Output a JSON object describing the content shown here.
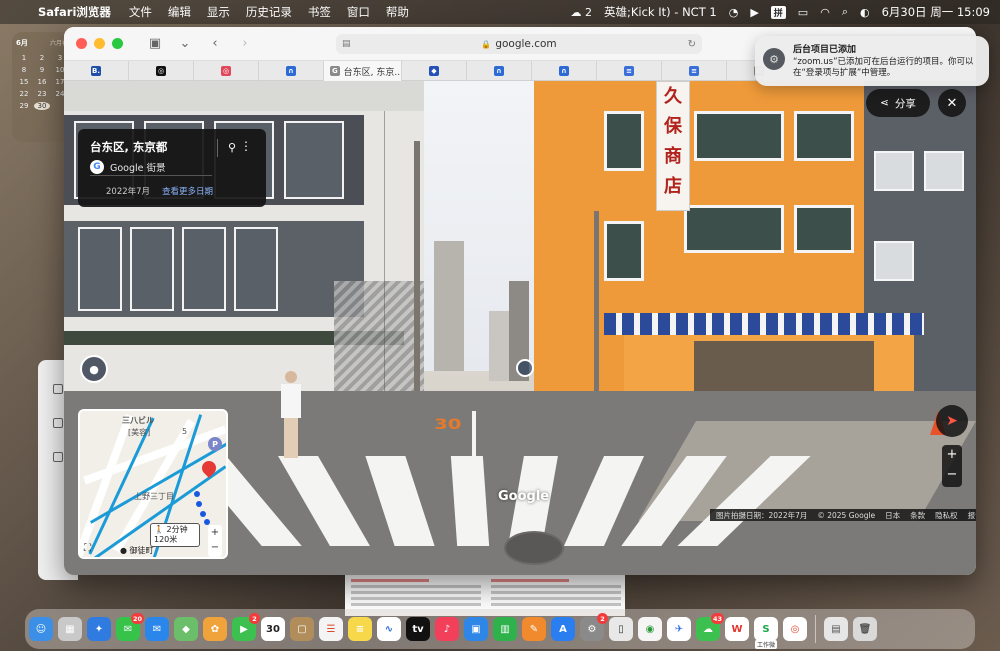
{
  "menubar": {
    "app_name": "Safari浏览器",
    "menus": [
      "文件",
      "编辑",
      "显示",
      "历史记录",
      "书签",
      "窗口",
      "帮助"
    ],
    "status": {
      "badge_count": "2",
      "now_playing": "英雄;Kick It) - NCT 1",
      "input_method": "拼",
      "datetime": "6月30日 周一 15:09"
    }
  },
  "calendar_widget": {
    "month": "6月",
    "subtitle": "六月初",
    "weekday": "日",
    "days": [
      "1",
      "2",
      "3",
      "8",
      "9",
      "10",
      "15",
      "16",
      "17",
      "22",
      "23",
      "24",
      "29",
      "30",
      ""
    ],
    "today": "30"
  },
  "safari": {
    "address": "google.com",
    "tabs": [
      {
        "icon": "B.",
        "color": "#1d4ea8"
      },
      {
        "icon": "◎",
        "color": "#111111"
      },
      {
        "icon": "◎",
        "color": "#e0475b"
      },
      {
        "icon": "∩",
        "color": "#2c6ad6"
      },
      {
        "icon": "G",
        "color": "#8a8a8a",
        "label": "台东区, 东京..."
      },
      {
        "icon": "◆",
        "color": "#2451b8"
      },
      {
        "icon": "∩",
        "color": "#2c6ad6"
      },
      {
        "icon": "∩",
        "color": "#2c6ad6"
      },
      {
        "icon": "≡",
        "color": "#3a6fd8"
      },
      {
        "icon": "≡",
        "color": "#3a6fd8"
      },
      {
        "icon": "G",
        "color": "#8a8a8a"
      }
    ]
  },
  "streetview": {
    "place": "台东区, 东京都",
    "provider": "Google 街景",
    "capture_month": "2022年7月",
    "more_dates": "查看更多日期",
    "share_label": "分享",
    "road_marking": "30",
    "shop_sign": "久保商店",
    "watermark": "Google",
    "footer": [
      "图片拍摄日期：2022年7月",
      "© 2025 Google",
      "日本",
      "条款",
      "隐私权",
      "报告问题"
    ],
    "minimap": {
      "labels": [
        "三八ビル",
        "[美容]",
        "5",
        "上野三丁目"
      ],
      "poi": "P",
      "walk_time": "2分钟",
      "walk_dist": "120米",
      "station": "御徒町",
      "zoom_in": "+",
      "zoom_out": "−"
    }
  },
  "notification": {
    "title": "后台项目已添加",
    "body": "“zoom.us”已添加可在后台运行的项目。你可以在“登录项与扩展”中管理。"
  },
  "dock": {
    "apps": [
      {
        "name": "finder",
        "color": "#3b8fe6",
        "glyph": "☺"
      },
      {
        "name": "launchpad",
        "color": "#c9c9c9",
        "glyph": "▦"
      },
      {
        "name": "safari",
        "color": "#2f7be0",
        "glyph": "✦"
      },
      {
        "name": "messages",
        "color": "#37c24a",
        "glyph": "✉",
        "badge": "20"
      },
      {
        "name": "mail",
        "color": "#2a86ea",
        "glyph": "✉"
      },
      {
        "name": "maps",
        "color": "#6cbf6a",
        "glyph": "◆"
      },
      {
        "name": "photos",
        "color": "#f0a33a",
        "glyph": "✿"
      },
      {
        "name": "facetime",
        "color": "#3cc04f",
        "glyph": "▶",
        "badge": "2"
      },
      {
        "name": "calendar",
        "color": "#ffffff",
        "glyph": "30",
        "text_color": "#222222"
      },
      {
        "name": "notes-brown",
        "color": "#b08d5a",
        "glyph": "▢"
      },
      {
        "name": "reminders",
        "color": "#f4f4f4",
        "glyph": "☰",
        "text_color": "#e0462c"
      },
      {
        "name": "notes",
        "color": "#f6d84a",
        "glyph": "≡"
      },
      {
        "name": "freeform",
        "color": "#ffffff",
        "glyph": "∿",
        "text_color": "#2a6ad8"
      },
      {
        "name": "apple-tv",
        "color": "#111111",
        "glyph": "tv"
      },
      {
        "name": "music",
        "color": "#f2405a",
        "glyph": "♪"
      },
      {
        "name": "keynote",
        "color": "#2e86e6",
        "glyph": "▣"
      },
      {
        "name": "numbers",
        "color": "#2fb24c",
        "glyph": "▥"
      },
      {
        "name": "pages",
        "color": "#f08a2c",
        "glyph": "✎"
      },
      {
        "name": "app-store",
        "color": "#2a7ef0",
        "glyph": "A"
      },
      {
        "name": "system-settings",
        "color": "#8a8a8a",
        "glyph": "⚙",
        "badge": "2"
      },
      {
        "name": "iphone-mirroring",
        "color": "#e8e8e8",
        "glyph": "▯",
        "text_color": "#333333"
      },
      {
        "name": "chrome-green",
        "color": "#f5f5f5",
        "glyph": "◉",
        "text_color": "#2c9a3c"
      },
      {
        "name": "lark",
        "color": "#ffffff",
        "glyph": "✈",
        "text_color": "#2a6ee8"
      },
      {
        "name": "wechat",
        "color": "#3cc04f",
        "glyph": "☁",
        "badge": "43"
      },
      {
        "name": "wps",
        "color": "#ffffff",
        "glyph": "W",
        "text_color": "#e0352c"
      },
      {
        "name": "wecom",
        "color": "#ffffff",
        "glyph": "S",
        "text_color": "#1aa84a",
        "label": "工作微"
      },
      {
        "name": "chrome",
        "color": "#ffffff",
        "glyph": "◎",
        "text_color": "#e0462c"
      },
      {
        "name": "downloads",
        "color": "#e6e6e6",
        "glyph": "▤",
        "text_color": "#555555"
      },
      {
        "name": "trash",
        "color": "#d9d9d9",
        "glyph": "🗑",
        "text_color": "#555555"
      }
    ]
  }
}
